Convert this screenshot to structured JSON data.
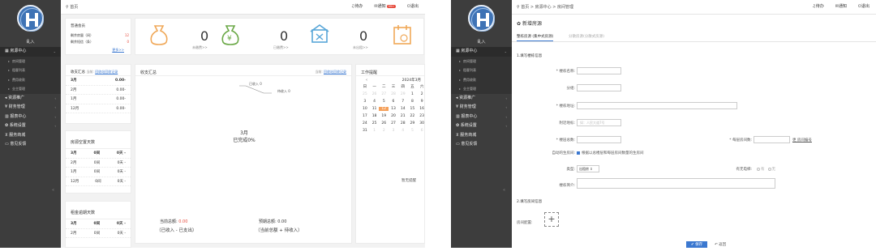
{
  "sidebar": {
    "user_name": "乱入",
    "menu": [
      {
        "label": "房源中心",
        "arrow": "⌄"
      },
      {
        "label": "资源推广",
        "arrow": "‹"
      },
      {
        "label": "财务管理",
        "arrow": "‹"
      },
      {
        "label": "报表中心",
        "arrow": "‹"
      },
      {
        "label": "系统设置",
        "arrow": "‹"
      },
      {
        "label": "服务商城",
        "arrow": ""
      },
      {
        "label": "意见反馈",
        "arrow": ""
      }
    ],
    "submenu": [
      "房间管理",
      "租客列表",
      "费用收款",
      "业主管理"
    ],
    "collapse_icon": "«"
  },
  "dashboard": {
    "breadcrumb": "首页",
    "topbar": {
      "todo": "待办",
      "notice": "通知",
      "badge": "99+",
      "logout": "退出"
    },
    "member": {
      "title": "普通会员",
      "rows": [
        {
          "label": "剩余房量（间）",
          "value": "12"
        },
        {
          "label": "剩余短信（条）",
          "value": "0"
        }
      ],
      "more": "更多>>"
    },
    "stats": [
      {
        "value": "0",
        "label": "未缴费>>"
      },
      {
        "value": "0",
        "label": "已缴费>>"
      },
      {
        "value": "0",
        "label": "未出租>>"
      }
    ],
    "income_summary": {
      "title": "收支汇总",
      "subtitle": "当前:",
      "link": "回收站回收记录",
      "rows": [
        {
          "month": "3月",
          "amount": "0.00-"
        },
        {
          "month": "2月",
          "amount": "0.00-"
        },
        {
          "month": "1月",
          "amount": "0.00-"
        },
        {
          "month": "12月",
          "amount": "0.00-"
        }
      ]
    },
    "vacancy": {
      "title": "房源空置天数",
      "rows": [
        {
          "month": "3月",
          "count": "0间",
          "days": "0天 -"
        },
        {
          "month": "2月",
          "count": "0间",
          "days": "0天 -"
        },
        {
          "month": "1月",
          "count": "0间",
          "days": "0天 -"
        },
        {
          "month": "12月",
          "count": "0间",
          "days": "0天 -"
        }
      ]
    },
    "rent_due": {
      "title": "租金逾期天数",
      "rows": [
        {
          "month": "3月",
          "count": "0间",
          "days": "0天 -"
        },
        {
          "month": "2月",
          "count": "0间",
          "days": "0天 -"
        }
      ]
    },
    "chart_card": {
      "title": "收支汇总",
      "current": "当前:",
      "link": "回收站回收记录",
      "legend_in": "已收入 0",
      "legend_out": "待收入 0",
      "center_month": "3月",
      "center_text": "已完成0%",
      "total_label": "当前总额:",
      "total_value": "0.00",
      "total_note": "（已收入 - 已支出）",
      "expect_label": "预期总额:",
      "expect_value": "0.00",
      "expect_note": "（当前总额 + 待收入）"
    },
    "calendar": {
      "title": "工作提醒",
      "month": "2024年3月",
      "weekdays": [
        "日",
        "一",
        "二",
        "三",
        "四",
        "五",
        "六"
      ],
      "days": [
        {
          "d": "25",
          "dim": true
        },
        {
          "d": "26",
          "dim": true
        },
        {
          "d": "27",
          "dim": true
        },
        {
          "d": "28",
          "dim": true
        },
        {
          "d": "29",
          "dim": true
        },
        {
          "d": "1",
          "dim": false
        },
        {
          "d": "2",
          "dim": false
        },
        {
          "d": "3",
          "dim": false
        },
        {
          "d": "4",
          "dim": false
        },
        {
          "d": "5",
          "dim": false
        },
        {
          "d": "6",
          "dim": false
        },
        {
          "d": "7",
          "dim": false
        },
        {
          "d": "8",
          "dim": false
        },
        {
          "d": "9",
          "dim": false
        },
        {
          "d": "10",
          "dim": false
        },
        {
          "d": "11",
          "dim": false
        },
        {
          "d": "12",
          "dim": false,
          "today": true
        },
        {
          "d": "13",
          "dim": false
        },
        {
          "d": "14",
          "dim": false
        },
        {
          "d": "15",
          "dim": false
        },
        {
          "d": "16",
          "dim": false
        },
        {
          "d": "17",
          "dim": false
        },
        {
          "d": "18",
          "dim": false
        },
        {
          "d": "19",
          "dim": false
        },
        {
          "d": "20",
          "dim": false
        },
        {
          "d": "21",
          "dim": false
        },
        {
          "d": "22",
          "dim": false
        },
        {
          "d": "23",
          "dim": false
        },
        {
          "d": "24",
          "dim": false
        },
        {
          "d": "25",
          "dim": false
        },
        {
          "d": "26",
          "dim": false
        },
        {
          "d": "27",
          "dim": false
        },
        {
          "d": "28",
          "dim": false
        },
        {
          "d": "29",
          "dim": false
        },
        {
          "d": "30",
          "dim": false
        },
        {
          "d": "31",
          "dim": false
        },
        {
          "d": "1",
          "dim": true
        },
        {
          "d": "2",
          "dim": true
        },
        {
          "d": "3",
          "dim": true
        },
        {
          "d": "4",
          "dim": true
        },
        {
          "d": "5",
          "dim": true
        },
        {
          "d": "6",
          "dim": true
        }
      ],
      "empty": "暂无提醒"
    }
  },
  "form_page": {
    "breadcrumb": "首页 > 房源中心 > 房间管理",
    "topbar": {
      "todo": "待办",
      "notice": "通知",
      "logout": "退出"
    },
    "page_title": "新增房源",
    "tabs": [
      "整栋房源 (集中式房源)",
      "分散房源(分散式房源)"
    ],
    "section1": "1.填写楼栋信息",
    "fields": {
      "building_name": "* 楼栋名称:",
      "unit": "分组:",
      "address": "* 楼栋地址:",
      "landmark": "附近地标:",
      "landmark_ph": "如：人民大道7号",
      "floors": "* 楼层总数:",
      "rooms_per_floor": "* 每层房间数:",
      "room_link": "更 房间编号",
      "auto_label": "自动的生房间:",
      "auto_text": "根据以总楼层和每层房间数量的生房间",
      "type": "类型:",
      "type_value": "出租房",
      "lift_label": "有无电梯:",
      "lift_yes": "有",
      "lift_no": "无",
      "intro": "楼栋简介:"
    },
    "section2": "2.填写房间信息",
    "room_config": "房间配置:",
    "add_icon": "+",
    "save": "保存",
    "back": "返回"
  }
}
